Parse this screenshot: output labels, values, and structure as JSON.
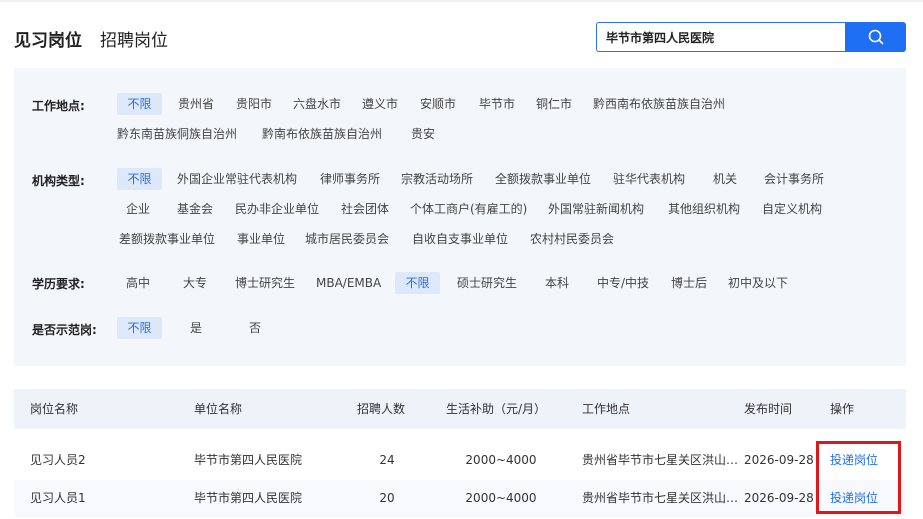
{
  "tabs": [
    {
      "label": "见习岗位"
    },
    {
      "label": "招聘岗位"
    }
  ],
  "search": {
    "value": "毕节市第四人民医院",
    "icon": "search-icon"
  },
  "filters": {
    "location": {
      "label": "工作地点:",
      "options": [
        "不限",
        "贵州省",
        "贵阳市",
        "六盘水市",
        "遵义市",
        "安顺市",
        "毕节市",
        "铜仁市",
        "黔西南布依族苗族自治州",
        "黔东南苗族侗族自治州",
        "黔南布依族苗族自治州",
        "贵安"
      ],
      "selected": "不限"
    },
    "org_type": {
      "label": "机构类型:",
      "options": [
        "不限",
        "外国企业常驻代表机构",
        "律师事务所",
        "宗教活动场所",
        "全额拨款事业单位",
        "驻华代表机构",
        "机关",
        "会计事务所",
        "企业",
        "基金会",
        "民办非企业单位",
        "社会团体",
        "个体工商户(有雇工的)",
        "外国常驻新闻机构",
        "其他组织机构",
        "自定义机构",
        "差额拨款事业单位",
        "事业单位",
        "城市居民委员会",
        "自收自支事业单位",
        "农村村民委员会"
      ],
      "selected": "不限"
    },
    "education": {
      "label": "学历要求:",
      "options": [
        "高中",
        "大专",
        "博士研究生",
        "MBA/EMBA",
        "不限",
        "硕士研究生",
        "本科",
        "中专/中技",
        "博士后",
        "初中及以下"
      ],
      "selected": "不限"
    },
    "demo": {
      "label": "是否示范岗:",
      "options": [
        "不限",
        "是",
        "否"
      ],
      "selected": "不限"
    }
  },
  "table": {
    "headers": [
      "岗位名称",
      "单位名称",
      "招聘人数",
      "生活补助（元/月）",
      "工作地点",
      "发布时间",
      "操作"
    ],
    "rows": [
      {
        "name": "见习人员2",
        "unit": "毕节市第四人民医院",
        "count": "24",
        "subsidy": "2000~4000",
        "location": "贵州省毕节市七星关区洪山…",
        "date": "2026-09-28",
        "action": "投递岗位"
      },
      {
        "name": "见习人员1",
        "unit": "毕节市第四人民医院",
        "count": "20",
        "subsidy": "2000~4000",
        "location": "贵州省毕节市七星关区洪山…",
        "date": "2026-09-28",
        "action": "投递岗位"
      }
    ]
  },
  "colors": {
    "accent": "#1f6ff5",
    "selected_bg": "#dde8fb",
    "panel_bg": "#f3f6fb",
    "highlight": "#e0161a"
  }
}
